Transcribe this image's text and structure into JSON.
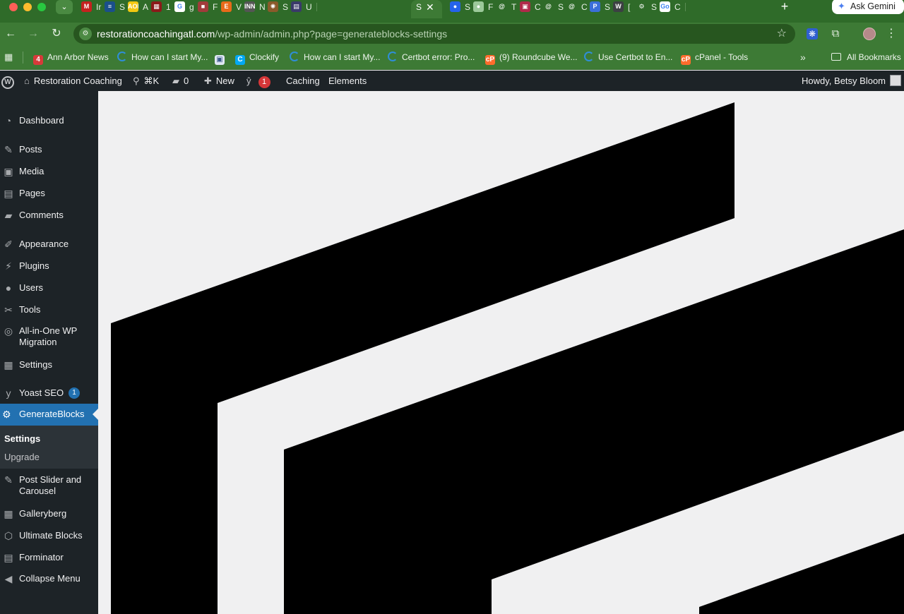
{
  "browser": {
    "tabs": [
      {
        "letter": "Ir",
        "icon": "gmail-icon",
        "fav": "M",
        "color": "#c5221f"
      },
      {
        "letter": "S",
        "icon": "site-icon",
        "fav": "≡",
        "color": "#1a4f8b"
      },
      {
        "letter": "A",
        "icon": "aol-icon",
        "fav": "AOL",
        "color": "#f2c811"
      },
      {
        "letter": "1",
        "icon": "calendar-icon",
        "fav": "▦",
        "color": "#8b1a1a"
      },
      {
        "letter": "g",
        "icon": "google-icon",
        "fav": "G",
        "color": "#ffffff"
      },
      {
        "letter": "F",
        "icon": "profile-photo-icon",
        "fav": "■",
        "color": "#a13b3b"
      },
      {
        "letter": "V",
        "icon": "etsy-icon",
        "fav": "E",
        "color": "#e86a1a"
      },
      {
        "letter": "N",
        "icon": "news-icon",
        "fav": "INN",
        "color": "#555555"
      },
      {
        "letter": "S",
        "icon": "seal-icon",
        "fav": "✺",
        "color": "#8a5a2a"
      },
      {
        "letter": "U",
        "icon": "document-icon",
        "fav": "▤",
        "color": "#3a3a6a"
      }
    ],
    "tabs_right": [
      {
        "letter": "S",
        "icon": "circle-blue-icon",
        "fav": "●",
        "color": "#2563eb"
      },
      {
        "letter": "F",
        "icon": "circle-green-icon",
        "fav": "●",
        "color": "#9cc99a"
      },
      {
        "letter": "T",
        "icon": "at-sign-icon",
        "fav": "@",
        "color": "#2f6b29"
      },
      {
        "letter": "C",
        "icon": "image-icon",
        "fav": "▣",
        "color": "#b02a4a"
      },
      {
        "letter": "S",
        "icon": "at-sign-icon",
        "fav": "@",
        "color": "#2f6b29"
      },
      {
        "letter": "C",
        "icon": "at-sign-icon",
        "fav": "@",
        "color": "#2f6b29"
      },
      {
        "letter": "S",
        "icon": "p-icon",
        "fav": "P",
        "color": "#3b6fd8"
      },
      {
        "letter": "[",
        "icon": "wordpress-icon",
        "fav": "W",
        "color": "#3c4043"
      },
      {
        "letter": "S",
        "icon": "gear-icon",
        "fav": "⚙",
        "color": "#2f6b29"
      },
      {
        "letter": "C",
        "icon": "go-icon",
        "fav": "Go",
        "color": "#ffffff"
      }
    ],
    "active_tab_letter": "S",
    "url_host": "restorationcoachingatl.com",
    "url_path": "/wp-admin/admin.php?page=generateblocks-settings",
    "ask_gemini": "Ask Gemini",
    "bookmarks": [
      {
        "label": "Ann Arbor News",
        "icon": "ann-arbor-news-icon",
        "fav": "4",
        "color": "#d83a3a"
      },
      {
        "label": "How can I start My...",
        "icon": "loading-arc-icon",
        "fav": "",
        "color": ""
      },
      {
        "label": "",
        "icon": "image-bookmark-icon",
        "fav": "▣",
        "color": "#dfe7f3"
      },
      {
        "label": "Clockify",
        "icon": "clockify-icon",
        "fav": "C",
        "color": "#03a9f4"
      },
      {
        "label": "How can I start My...",
        "icon": "loading-arc-icon",
        "fav": "",
        "color": ""
      },
      {
        "label": "Certbot error: Pro...",
        "icon": "loading-arc-icon",
        "fav": "",
        "color": ""
      },
      {
        "label": "(9) Roundcube We...",
        "icon": "cpanel-icon",
        "fav": "cP",
        "color": "#ff6c2c"
      },
      {
        "label": "Use Certbot to En...",
        "icon": "loading-arc-icon",
        "fav": "",
        "color": ""
      },
      {
        "label": "cPanel - Tools",
        "icon": "cpanel-icon",
        "fav": "cP",
        "color": "#ff6c2c"
      }
    ],
    "bookmarks_more": "»",
    "all_bookmarks": "All Bookmarks"
  },
  "adminbar": {
    "site_name": "Restoration Coaching",
    "search_shortcut": "⌘K",
    "comments_count": "0",
    "new_label": "New",
    "yoast_badge": "1",
    "caching": "Caching",
    "elements": "Elements",
    "howdy": "Howdy, Betsy Bloom"
  },
  "sidebar": {
    "items": [
      {
        "label": "Dashboard",
        "icon": "dashboard-icon",
        "glyph": "◔"
      },
      {
        "label": "Posts",
        "icon": "pin-icon",
        "glyph": "✎"
      },
      {
        "label": "Media",
        "icon": "media-icon",
        "glyph": "▣"
      },
      {
        "label": "Pages",
        "icon": "pages-icon",
        "glyph": "▤"
      },
      {
        "label": "Comments",
        "icon": "comment-icon",
        "glyph": "▰"
      },
      {
        "label": "Appearance",
        "icon": "brush-icon",
        "glyph": "✐"
      },
      {
        "label": "Plugins",
        "icon": "plug-icon",
        "glyph": "⚡"
      },
      {
        "label": "Users",
        "icon": "user-icon",
        "glyph": "●"
      },
      {
        "label": "Tools",
        "icon": "wrench-icon",
        "glyph": "✂"
      },
      {
        "label": "All-in-One WP Migration",
        "icon": "migration-icon",
        "glyph": "◎"
      },
      {
        "label": "Settings",
        "icon": "settings-icon",
        "glyph": "▦"
      },
      {
        "label": "Yoast SEO",
        "icon": "yoast-icon",
        "glyph": "y",
        "badge": "1"
      }
    ],
    "current": {
      "label": "GenerateBlocks",
      "icon": "gear-icon",
      "glyph": "⚙"
    },
    "submenu": {
      "settings": "Settings",
      "upgrade": "Upgrade"
    },
    "items_after": [
      {
        "label": "Post Slider and Carousel",
        "icon": "pushpin-icon",
        "glyph": "✎"
      },
      {
        "label": "Galleryberg",
        "icon": "gallery-grid-icon",
        "glyph": "▦"
      },
      {
        "label": "Ultimate Blocks",
        "icon": "hexagon-icon",
        "glyph": "⬡"
      },
      {
        "label": "Forminator",
        "icon": "clipboard-icon",
        "glyph": "▤"
      },
      {
        "label": "Collapse Menu",
        "icon": "collapse-arrow-icon",
        "glyph": "◀"
      }
    ]
  }
}
